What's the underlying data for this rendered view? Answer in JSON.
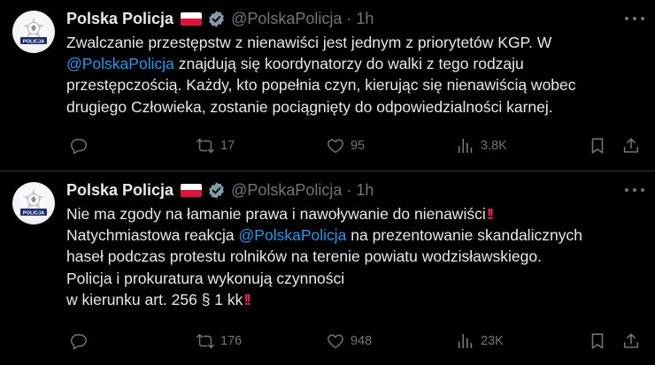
{
  "tweets": [
    {
      "author": {
        "name": "Polska Policja",
        "handle": "@PolskaPolicja",
        "separator": "·",
        "time": "1h",
        "avatar_text": "POLICJA"
      },
      "lines": [
        [
          {
            "t": "Zwalczanie przestępstw z nienawiści jest jednym z priorytetów KGP. W"
          }
        ],
        [
          {
            "t": "@PolskaPolicja",
            "mention": true
          },
          {
            "t": " znajdują się koordynatorzy do walki z tego rodzaju"
          }
        ],
        [
          {
            "t": "przestępczością. Każdy, kto popełnia czyn, kierując się nienawiścią wobec"
          }
        ],
        [
          {
            "t": "drugiego Człowieka, zostanie pociągnięty do odpowiedzialności karnej."
          }
        ]
      ],
      "stats": {
        "replies": "",
        "retweets": "17",
        "likes": "95",
        "views": "3.8K"
      }
    },
    {
      "author": {
        "name": "Polska Policja",
        "handle": "@PolskaPolicja",
        "separator": "·",
        "time": "1h",
        "avatar_text": "POLICJA"
      },
      "lines": [
        [
          {
            "t": "Nie ma zgody na łamanie prawa i nawoływanie do nienawiści"
          },
          {
            "t": "!!",
            "emoji": true
          }
        ],
        [
          {
            "t": "Natychmiastowa reakcja "
          },
          {
            "t": "@PolskaPolicja",
            "mention": true
          },
          {
            "t": " na prezentowanie skandalicznych"
          }
        ],
        [
          {
            "t": "haseł podczas protestu rolników na terenie powiatu wodzisławskiego."
          }
        ],
        [
          {
            "t": "Policja i prokuratura wykonują czynności"
          }
        ],
        [
          {
            "t": "w kierunku art. 256 § 1 kk"
          },
          {
            "t": "!!",
            "emoji": true
          }
        ]
      ],
      "stats": {
        "replies": "",
        "retweets": "176",
        "likes": "948",
        "views": "23K"
      }
    }
  ],
  "icons": {
    "more": "more-dots-icon",
    "reply": "reply-bubble-icon",
    "retweet": "retweet-arrows-icon",
    "like": "heart-icon",
    "views": "bar-chart-icon",
    "bookmark": "bookmark-icon",
    "share": "share-upload-icon",
    "verified": "verified-badge-icon",
    "flag": "poland-flag-icon"
  },
  "colors": {
    "background": "#000000",
    "text": "#e7e9ea",
    "muted": "#71767b",
    "link": "#1d9bf0",
    "divider": "#2f3336",
    "emoji_red": "#e0245e",
    "verified_badge": "#829aab",
    "flag_white": "#ffffff",
    "flag_red": "#dc143c"
  }
}
